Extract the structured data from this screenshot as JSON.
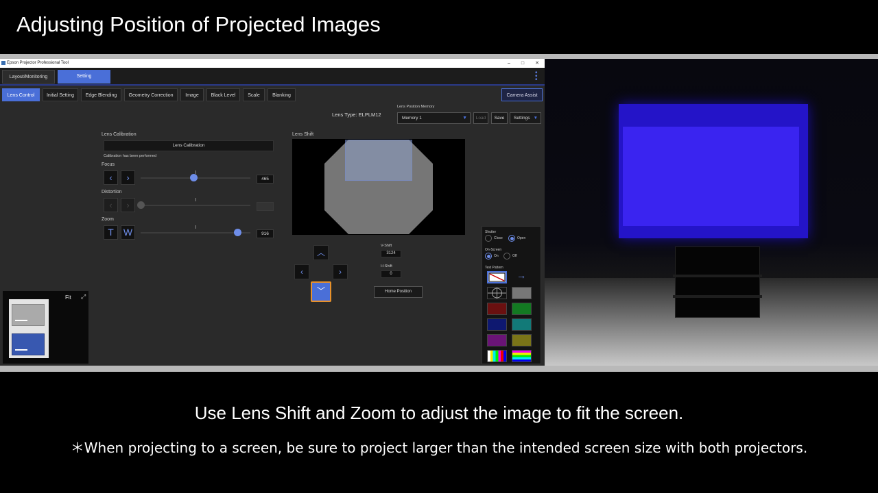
{
  "video": {
    "title": "Adjusting Position of Projected Images",
    "caption": "Use Lens Shift and Zoom to adjust the image to fit the screen.",
    "note": "＊When projecting to a screen, be sure to project larger than the intended screen size with both projectors."
  },
  "window": {
    "title": "Epson Projector Professional Tool",
    "controls": [
      "–",
      "□",
      "✕"
    ]
  },
  "top_tabs": [
    {
      "label": "Layout/Monitoring",
      "active": false
    },
    {
      "label": "Setting",
      "active": true
    }
  ],
  "sub_tabs": [
    {
      "label": "Lens Control",
      "active": true
    },
    {
      "label": "Initial Setting",
      "active": false
    },
    {
      "label": "Edge Blending",
      "active": false
    },
    {
      "label": "Geometry Correction",
      "active": false
    },
    {
      "label": "Image",
      "active": false
    },
    {
      "label": "Black Level",
      "active": false
    },
    {
      "label": "Scale",
      "active": false
    },
    {
      "label": "Blanking",
      "active": false
    }
  ],
  "camera_assist_label": "Camera Assist",
  "lens_type": "Lens Type: ELPLM12",
  "lens_position_memory": {
    "label": "Lens Position Memory",
    "selected": "Memory 1",
    "load_label": "Load",
    "save_label": "Save",
    "settings_label": "Settings"
  },
  "lens_calibration": {
    "title": "Lens Calibration",
    "button_label": "Lens Calibration",
    "status": "Calibration has been performed"
  },
  "focus": {
    "label": "Focus",
    "value": "465",
    "level": 0.48
  },
  "distortion": {
    "label": "Distortion",
    "value": "",
    "level": 0.0,
    "enabled": false
  },
  "zoom": {
    "label": "Zoom",
    "value": "916",
    "level": 0.88,
    "tele": "T",
    "wide": "W"
  },
  "lens_shift": {
    "title": "Lens Shift",
    "v_shift_label": "V-Shift",
    "v_shift_value": "3124",
    "h_shift_label": "H-Shift",
    "h_shift_value": "0",
    "home_label": "Home Position"
  },
  "side_panel": {
    "shutter_label": "Shutter",
    "shutter_close": "Close",
    "shutter_open": "Open",
    "onscreen_label": "On-Screen",
    "onscreen_on": "On",
    "onscreen_off": "Off",
    "test_pattern_label": "Test Pattern"
  },
  "navigator": {
    "fit_label": "Fit"
  },
  "colors": {
    "accent": "#4a6fd8",
    "highlight": "#e8912a",
    "projection": "#3a24f0"
  }
}
